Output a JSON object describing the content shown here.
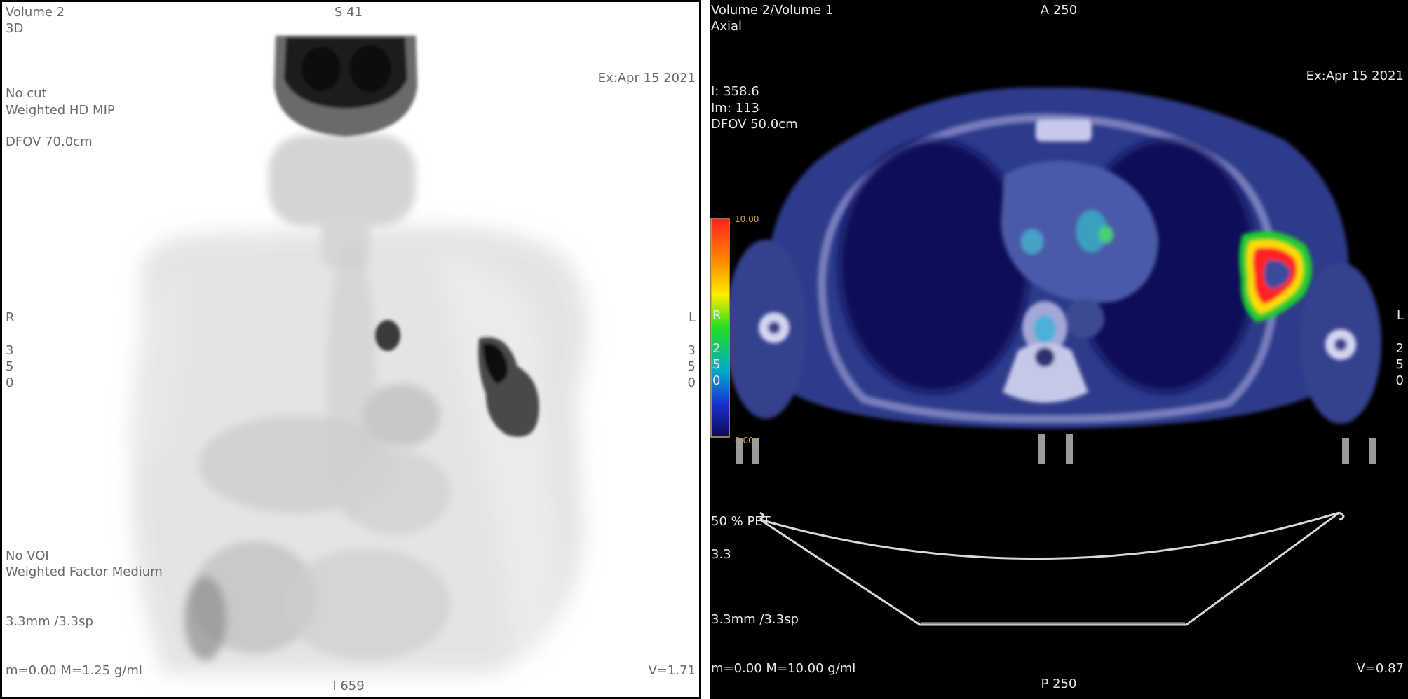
{
  "left": {
    "volume": "Volume 2",
    "mode": "3D",
    "orientation_top": "S 41",
    "date": "Ex:Apr 15 2021",
    "cut": "No cut",
    "render": "Weighted HD MIP",
    "dfov": "DFOV 70.0cm",
    "side_left": [
      "R",
      "3",
      "5",
      "0"
    ],
    "side_right": [
      "L",
      "3",
      "5",
      "0"
    ],
    "voi": "No VOI",
    "weighted_factor": "Weighted Factor Medium",
    "thickness": "3.3mm /3.3sp",
    "window": "m=0.00 M=1.25 g/ml",
    "v": "V=1.71",
    "orientation_bottom": "I 659"
  },
  "right": {
    "volume": "Volume 2/Volume 1",
    "mode": "Axial",
    "orientation_top": "A 250",
    "date": "Ex:Apr 15 2021",
    "intensity": "I: 358.6",
    "image": "Im: 113",
    "dfov": "DFOV 50.0cm",
    "side_left": [
      "R",
      "2",
      "5",
      "0"
    ],
    "side_right": [
      "L",
      "2",
      "5",
      "0"
    ],
    "colorbar_max": "10.00",
    "colorbar_min": "0.00",
    "blend": "50 % PET",
    "blend_value": "3.3",
    "thickness": "3.3mm /3.3sp",
    "window": "m=0.00 M=10.00 g/ml",
    "v": "V=0.87",
    "orientation_bottom": "P 250"
  }
}
